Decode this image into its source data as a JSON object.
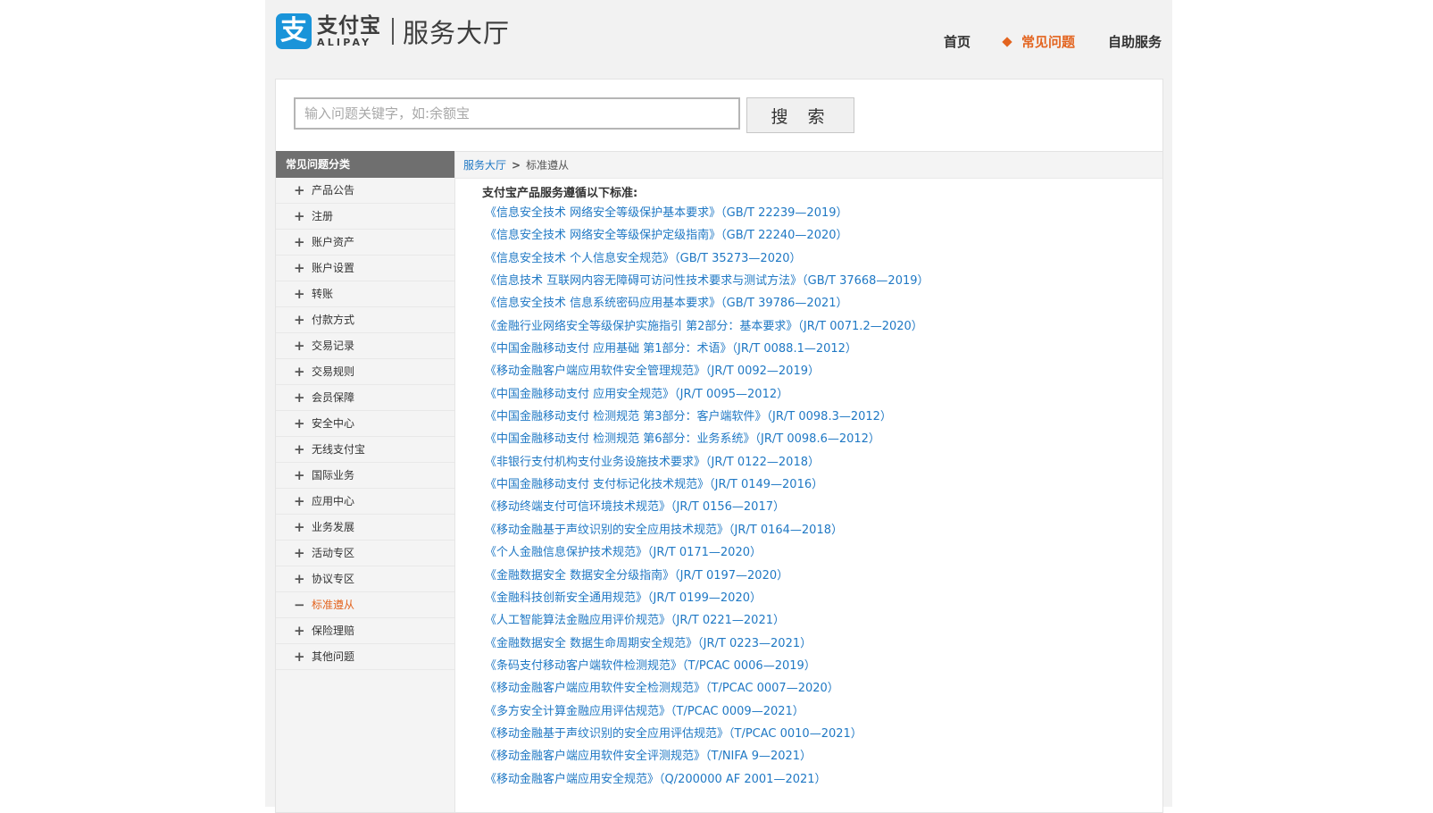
{
  "header": {
    "logo_mark": "支",
    "logo_cn": "支付宝",
    "logo_en": "ALIPAY",
    "service_title": "服务大厅",
    "nav": [
      {
        "label": "首页",
        "active": false
      },
      {
        "label": "常见问题",
        "active": true
      },
      {
        "label": "自助服务",
        "active": false
      }
    ]
  },
  "search": {
    "placeholder": "输入问题关键字，如:余额宝",
    "value": "",
    "button_label": "搜 索"
  },
  "sidebar": {
    "title": "常见问题分类",
    "items": [
      {
        "label": "产品公告",
        "sign": "+"
      },
      {
        "label": "注册",
        "sign": "+"
      },
      {
        "label": "账户资产",
        "sign": "+"
      },
      {
        "label": "账户设置",
        "sign": "+"
      },
      {
        "label": "转账",
        "sign": "+"
      },
      {
        "label": "付款方式",
        "sign": "+"
      },
      {
        "label": "交易记录",
        "sign": "+"
      },
      {
        "label": "交易规则",
        "sign": "+"
      },
      {
        "label": "会员保障",
        "sign": "+"
      },
      {
        "label": "安全中心",
        "sign": "+"
      },
      {
        "label": "无线支付宝",
        "sign": "+"
      },
      {
        "label": "国际业务",
        "sign": "+"
      },
      {
        "label": "应用中心",
        "sign": "+"
      },
      {
        "label": "业务发展",
        "sign": "+"
      },
      {
        "label": "活动专区",
        "sign": "+"
      },
      {
        "label": "协议专区",
        "sign": "+"
      },
      {
        "label": "标准遵从",
        "sign": "−"
      },
      {
        "label": "保险理赔",
        "sign": "+"
      },
      {
        "label": "其他问题",
        "sign": "+"
      }
    ]
  },
  "breadcrumb": {
    "root": "服务大厅",
    "separator": ">",
    "current": "标准遵从"
  },
  "content": {
    "title": "支付宝产品服务遵循以下标准:",
    "standards": [
      "《信息安全技术 网络安全等级保护基本要求》（GB/T 22239—2019）",
      "《信息安全技术 网络安全等级保护定级指南》（GB/T 22240—2020）",
      "《信息安全技术 个人信息安全规范》（GB/T 35273—2020）",
      "《信息技术 互联网内容无障碍可访问性技术要求与测试方法》（GB/T 37668—2019）",
      "《信息安全技术 信息系统密码应用基本要求》（GB/T 39786—2021）",
      "《金融行业网络安全等级保护实施指引 第2部分：基本要求》（JR/T 0071.2—2020）",
      "《中国金融移动支付 应用基础 第1部分：术语》（JR/T 0088.1—2012）",
      "《移动金融客户端应用软件安全管理规范》（JR/T 0092—2019）",
      "《中国金融移动支付 应用安全规范》（JR/T 0095—2012）",
      "《中国金融移动支付 检测规范 第3部分：客户端软件》（JR/T 0098.3—2012）",
      "《中国金融移动支付 检测规范 第6部分：业务系统》（JR/T 0098.6—2012）",
      "《非银行支付机构支付业务设施技术要求》（JR/T 0122—2018）",
      "《中国金融移动支付 支付标记化技术规范》（JR/T 0149—2016）",
      "《移动终端支付可信环境技术规范》（JR/T 0156—2017）",
      "《移动金融基于声纹识别的安全应用技术规范》（JR/T 0164—2018）",
      "《个人金融信息保护技术规范》（JR/T 0171—2020）",
      "《金融数据安全 数据安全分级指南》（JR/T 0197—2020）",
      "《金融科技创新安全通用规范》（JR/T 0199—2020）",
      "《人工智能算法金融应用评价规范》（JR/T 0221—2021）",
      "《金融数据安全 数据生命周期安全规范》（JR/T 0223—2021）",
      "《条码支付移动客户端软件检测规范》（T/PCAC 0006—2019）",
      "《移动金融客户端应用软件安全检测规范》（T/PCAC 0007—2020）",
      "《多方安全计算金融应用评估规范》（T/PCAC 0009—2021）",
      "《移动金融基于声纹识别的安全应用评估规范》（T/PCAC 0010—2021）",
      "《移动金融客户端应用软件安全评测规范》（T/NIFA 9—2021）",
      "《移动金融客户端应用安全规范》（Q/200000 AF 2001—2021）"
    ]
  },
  "colors": {
    "link": "#1f78c4",
    "accent": "#e3641f",
    "logo": "#1a94d9",
    "sidebar_header": "#6f6f6f"
  }
}
